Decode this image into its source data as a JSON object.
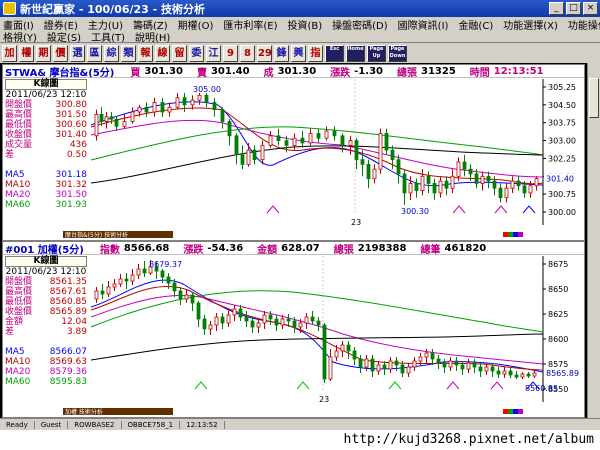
{
  "window": {
    "title": "新世紀贏家 - 100/06/23 - 技術分析"
  },
  "menu1": [
    "畫面(I)",
    "證券(E)",
    "主力(U)",
    "籌碼(Z)",
    "期權(O)",
    "匯市利率(E)",
    "投資(B)",
    "操盤密碼(D)",
    "國際資訊(I)",
    "金融(C)",
    "功能選擇(X)",
    "功能操作(F)"
  ],
  "menu2": [
    "格視(Y)",
    "設定(S)",
    "工具(T)",
    "說明(H)"
  ],
  "toolbar": [
    "加",
    "權",
    "期",
    "價",
    "選",
    "區",
    "綜",
    "類",
    "報",
    "線",
    "留",
    "委",
    "江",
    "9",
    "8",
    "29",
    "鋒",
    "興",
    "指"
  ],
  "toolbar_extra": [
    "Esc",
    "Home",
    "Page Up",
    "Page Down"
  ],
  "panel1": {
    "name": "STWA& 摩台指&(5分)",
    "fields": [
      {
        "label": "買",
        "value": "301.30"
      },
      {
        "label": "賣",
        "value": "301.40"
      },
      {
        "label": "成",
        "value": "301.30"
      },
      {
        "label": "漲跌",
        "value": "-1.30"
      },
      {
        "label": "總張",
        "value": "31325"
      },
      {
        "label": "時間",
        "value": "12:13:51"
      }
    ],
    "ktitle": "K線圖",
    "date": "2011/06/23 12:10",
    "stats": [
      {
        "k": "開盤價",
        "v": "300.80"
      },
      {
        "k": "最高價",
        "v": "301.50"
      },
      {
        "k": "最低價",
        "v": "300.60"
      },
      {
        "k": "收盤價",
        "v": "301.40"
      },
      {
        "k": "成交量",
        "v": "436"
      },
      {
        "k": "差",
        "v": "0.50"
      }
    ],
    "ma": [
      {
        "k": "MA5",
        "v": "301.18"
      },
      {
        "k": "MA10",
        "v": "301.32"
      },
      {
        "k": "MA20",
        "v": "301.50"
      },
      {
        "k": "MA60",
        "v": "301.93"
      }
    ],
    "yticks": [
      "305.25",
      "304.50",
      "303.75",
      "303.00",
      "302.25",
      "301.50",
      "300.75",
      "300.00"
    ],
    "current": "301.40",
    "high_label": "305.00",
    "low_label": "300.30",
    "day_label": "23",
    "footer": "摩台指&(5分) 技術分析"
  },
  "panel2": {
    "name": "#001 加權(5分)",
    "fields": [
      {
        "label": "指數",
        "value": "8566.68"
      },
      {
        "label": "漲跌",
        "value": "-54.36"
      },
      {
        "label": "金額",
        "value": "628.07"
      },
      {
        "label": "總張",
        "value": "2198388"
      },
      {
        "label": "總筆",
        "value": "461820"
      }
    ],
    "ktitle": "K線圖",
    "date": "2011/06/23 12:10",
    "stats": [
      {
        "k": "開盤價",
        "v": "8561.35"
      },
      {
        "k": "最高價",
        "v": "8567.61"
      },
      {
        "k": "最低價",
        "v": "8560.85"
      },
      {
        "k": "收盤價",
        "v": "8565.89"
      },
      {
        "k": "金額",
        "v": "12.04"
      },
      {
        "k": "差",
        "v": "3.89"
      }
    ],
    "ma": [
      {
        "k": "MA5",
        "v": "8566.07"
      },
      {
        "k": "MA10",
        "v": "8569.63"
      },
      {
        "k": "MA20",
        "v": "8579.36"
      },
      {
        "k": "MA60",
        "v": "8595.83"
      }
    ],
    "yticks": [
      "8675",
      "8650",
      "8625",
      "8600",
      "8575",
      "8550"
    ],
    "current": "8565.89",
    "high_label": "8679.37",
    "low_label": "8560.85",
    "day_label": "23",
    "footer": "加權 技術分析"
  },
  "status": [
    "Ready",
    "Guest",
    "ROWBASE2",
    "OBBCE758_1",
    "12:13:52"
  ],
  "url": "http://kujd3268.pixnet.net/album",
  "colors": {
    "up": "#c00000",
    "down": "#008000",
    "ma5": "#0000ff",
    "ma10": "#c00000",
    "ma20": "#c000c0",
    "ma60": "#00a000"
  }
}
